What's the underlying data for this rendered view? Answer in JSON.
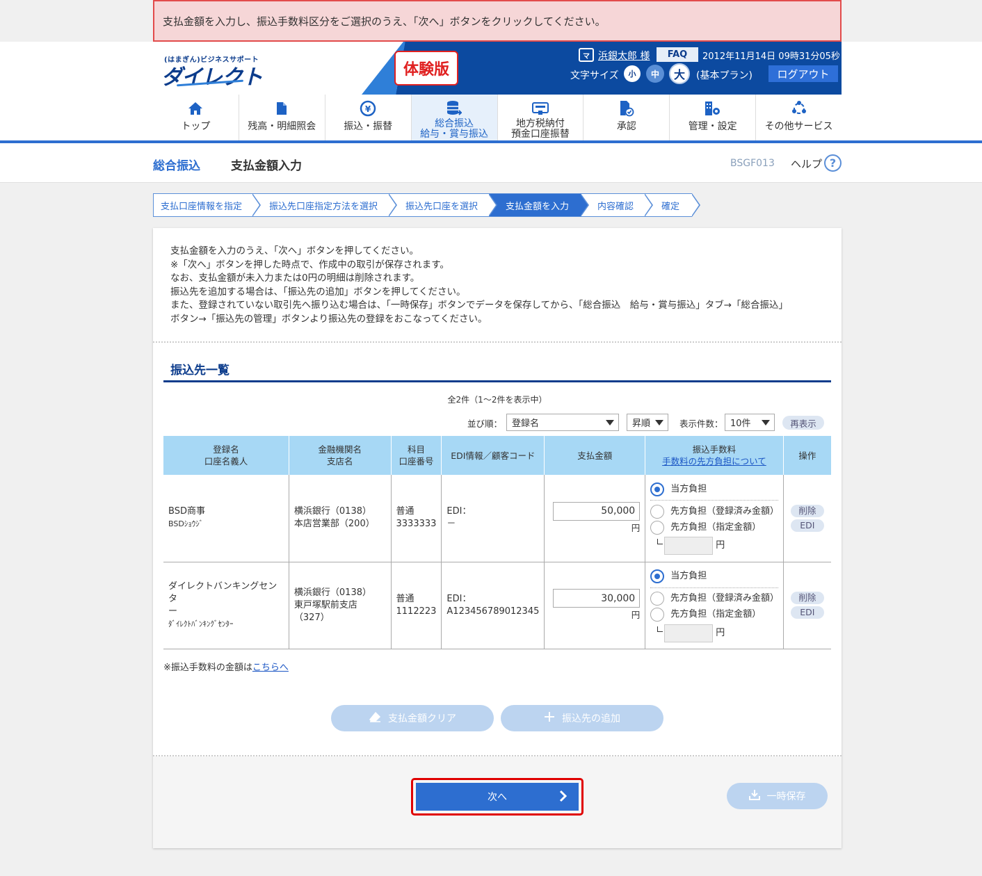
{
  "banner": "支払金額を入力し、振込手数料区分をご選択のうえ、「次へ」ボタンをクリックしてください。",
  "header": {
    "logo_sub": "(はまぎん)ビジネスサポート",
    "logo_main": "ダイレクト",
    "trial": "体験版",
    "bank_icon": "マ",
    "user": "浜銀太郎 様",
    "faq": "FAQ",
    "datetime": "2012年11月14日 09時31分05秒",
    "font_size_label": "文字サイズ",
    "fs_small": "小",
    "fs_mid": "中",
    "fs_large": "大",
    "plan": "(基本プラン)",
    "logout": "ログアウト"
  },
  "nav": [
    {
      "label": "トップ",
      "icon": "home-icon"
    },
    {
      "label": "残高・明細照会",
      "icon": "document-icon"
    },
    {
      "label": "振込・振替",
      "icon": "yen-transfer-icon"
    },
    {
      "label1": "総合振込",
      "label2": "給与・賞与振込",
      "icon": "database-icon"
    },
    {
      "label1": "地方税納付",
      "label2": "預金口座振替",
      "icon": "card-icon"
    },
    {
      "label": "承認",
      "icon": "approval-icon"
    },
    {
      "label": "管理・設定",
      "icon": "settings-icon"
    },
    {
      "label": "その他サービス",
      "icon": "network-icon"
    }
  ],
  "titlebar": {
    "section": "総合振込",
    "title": "支払金額入力",
    "code": "BSGF013",
    "help": "ヘルプ",
    "help_icon": "?"
  },
  "steps": [
    "支払口座情報を指定",
    "振込先口座指定方法を選択",
    "振込先口座を選択",
    "支払金額を入力",
    "内容確認",
    "確定"
  ],
  "intro": [
    "支払金額を入力のうえ、「次へ」ボタンを押してください。",
    "※「次へ」ボタンを押した時点で、作成中の取引が保存されます。",
    "なお、支払金額が未入力または0円の明細は削除されます。",
    "振込先を追加する場合は、「振込先の追加」ボタンを押してください。",
    "また、登録されていない取引先へ振り込む場合は、「一時保存」ボタンでデータを保存してから、「総合振込　給与・賞与振込」タブ→「総合振込」",
    "ボタン→「振込先の管理」ボタンより振込先の登録をおこなってください。"
  ],
  "list": {
    "title": "振込先一覧",
    "count": "全2件（1～2件を表示中）",
    "sort_label": "並び順：",
    "sort_value": "登録名",
    "order_value": "昇順",
    "display_label": "表示件数：",
    "display_value": "10件",
    "redisplay": "再表示"
  },
  "table": {
    "headers": {
      "name1": "登録名",
      "name2": "口座名義人",
      "bank1": "金融機関名",
      "bank2": "支店名",
      "acct1": "科目",
      "acct2": "口座番号",
      "edi": "EDI情報／顧客コード",
      "amount": "支払金額",
      "fee1": "振込手数料",
      "fee_link": "手数料の先方負担について",
      "op": "操作"
    },
    "rows": [
      {
        "name": "BSD商事",
        "kana": "BSDｼｮｳｼﾞ",
        "bank": "横浜銀行（0138）",
        "branch": "本店営業部（200）",
        "branch2": "",
        "acct_type": "普通",
        "acct_no": "3333333",
        "edi_label": "EDI：",
        "edi_value": "－",
        "amount": "50,000",
        "yen": "円"
      },
      {
        "name": "ダイレクトバンキングセンタ",
        "name2": "ー",
        "kana": "ﾀﾞｲﾚｸﾄﾊﾞﾝｷﾝｸﾞｾﾝﾀｰ",
        "bank": "横浜銀行（0138）",
        "branch": "東戸塚駅前支店",
        "branch2": "（327）",
        "acct_type": "普通",
        "acct_no": "1112223",
        "edi_label": "EDI：",
        "edi_value": "A123456789012345",
        "amount": "30,000",
        "yen": "円"
      }
    ],
    "fee_opt1": "当方負担",
    "fee_opt2": "先方負担（登録済み金額）",
    "fee_opt3": "先方負担（指定金額）",
    "fee_yen": "円",
    "delete": "削除",
    "edi": "EDI"
  },
  "fee_note": "※振込手数料の金額は",
  "fee_note_link": "こちらへ",
  "buttons": {
    "clear": "支払金額クリア",
    "add": "振込先の追加",
    "next": "次へ",
    "save": "一時保存"
  },
  "colors": {
    "brand": "#0c4aa0",
    "accent": "#2d6ed0",
    "table_header": "#a7d8f5",
    "alert": "#e02020"
  }
}
